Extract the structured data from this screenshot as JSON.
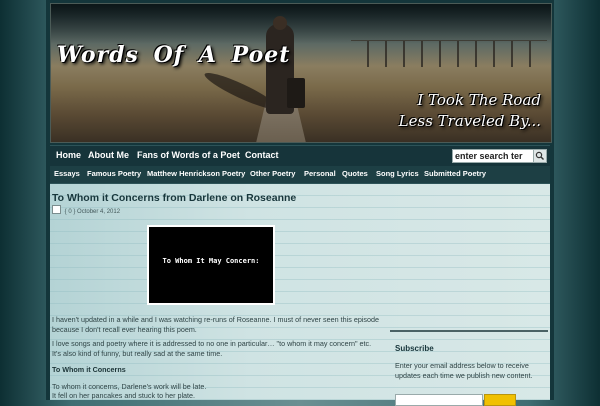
{
  "header": {
    "site_title": "Words Of A Poet",
    "tagline_line1": "I Took The Road",
    "tagline_line2": "Less Traveled By..."
  },
  "main_nav": {
    "items": [
      {
        "label": "Home"
      },
      {
        "label": "About Me"
      },
      {
        "label": "Fans of Words of a Poet"
      },
      {
        "label": "Contact"
      }
    ],
    "search_value": "enter search ter"
  },
  "category_nav": {
    "items": [
      {
        "label": "Essays"
      },
      {
        "label": "Famous Poetry"
      },
      {
        "label": "Matthew Henrickson Poetry"
      },
      {
        "label": "Other Poetry"
      },
      {
        "label": "Personal"
      },
      {
        "label": "Quotes"
      },
      {
        "label": "Song Lyrics"
      },
      {
        "label": "Submitted Poetry"
      }
    ]
  },
  "post": {
    "title": "To Whom it Concerns from Darlene on Roseanne",
    "comments": "{ 0 }",
    "date": "October 4, 2012",
    "image_text": "To Whom It May Concern:",
    "paragraph1": "I haven't updated in a while and I was watching re-runs of Roseanne. I must of never seen this episode because I don't recall ever hearing this poem.",
    "paragraph2": "I love songs and poetry where it is addressed to no one in particular… \"to whom it may concern\" etc. It's also kind of funny, but really sad at the same time.",
    "subheading": "To Whom it Concerns",
    "line1": "To whom it concerns, Darlene's work will be late.",
    "line2": "It fell on her pancakes and stuck to her plate."
  },
  "sidebar": {
    "subscribe_title": "Subscribe",
    "subscribe_text": "Enter your email address below to receive updates each time we publish new content."
  }
}
